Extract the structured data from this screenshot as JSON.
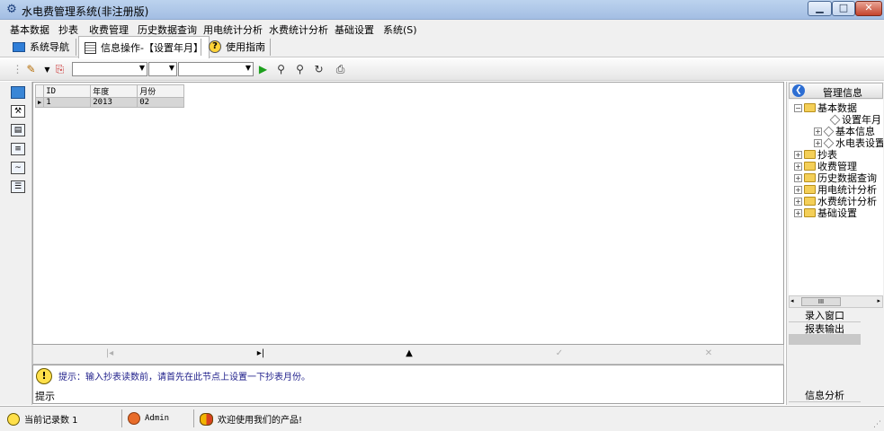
{
  "window": {
    "title": "水电费管理系统(非注册版)",
    "controls": {
      "minimize": "▁",
      "maximize": "□",
      "close": "✕"
    }
  },
  "menu": [
    "基本数据",
    "抄表",
    "收费管理",
    "历史数据查询",
    "用电统计分析",
    "水费统计分析",
    "基础设置",
    "系统(S)"
  ],
  "tabs": [
    {
      "label": "系统导航",
      "icon": "monitor-icon",
      "active": false
    },
    {
      "label": "信息操作-【设置年月】",
      "icon": "form-icon",
      "active": true
    },
    {
      "label": "使用指南",
      "icon": "help-icon",
      "active": false
    }
  ],
  "toolbar": {
    "combo1_value": "",
    "combo2_value": "",
    "combo3_value": "",
    "icons": [
      "pencil-icon",
      "preview-icon",
      "run-icon",
      "find-user-icon",
      "search-user-icon",
      "refresh-icon",
      "print-icon"
    ]
  },
  "grid": {
    "columns": [
      "ID",
      "年度",
      "月份"
    ],
    "rows": [
      [
        "1",
        "2013",
        "02"
      ]
    ]
  },
  "navigator": {
    "first": "|◂",
    "next": "▸|",
    "up": "▲",
    "check": "✓",
    "cancel": "✕"
  },
  "hint": {
    "label": "提示",
    "text": "提示：输入抄表读数前，请首先在此节点上设置一下抄表月份。"
  },
  "rightpanel": {
    "title": "管理信息",
    "tree": [
      {
        "label": "基本数据",
        "level": 0,
        "type": "folder",
        "expander": "−"
      },
      {
        "label": "设置年月",
        "level": 2,
        "type": "item",
        "expander": ""
      },
      {
        "label": "基本信息",
        "level": 1,
        "type": "item",
        "expander": "+"
      },
      {
        "label": "水电表设置",
        "level": 1,
        "type": "item",
        "expander": "+"
      },
      {
        "label": "抄表",
        "level": 0,
        "type": "folder",
        "expander": "+"
      },
      {
        "label": "收费管理",
        "level": 0,
        "type": "folder",
        "expander": "+"
      },
      {
        "label": "历史数据查询",
        "level": 0,
        "type": "folder",
        "expander": "+"
      },
      {
        "label": "用电统计分析",
        "level": 0,
        "type": "folder",
        "expander": "+"
      },
      {
        "label": "水费统计分析",
        "level": 0,
        "type": "folder",
        "expander": "+"
      },
      {
        "label": "基础设置",
        "level": 0,
        "type": "folder",
        "expander": "+"
      }
    ],
    "scroll_label": "III",
    "buttons": [
      "录入窗口",
      "报表输出"
    ],
    "bottom_button": "信息分析"
  },
  "status": {
    "record_count": "当前记录数 1",
    "user": "Admin",
    "welcome": "欢迎使用我们的产品!"
  }
}
